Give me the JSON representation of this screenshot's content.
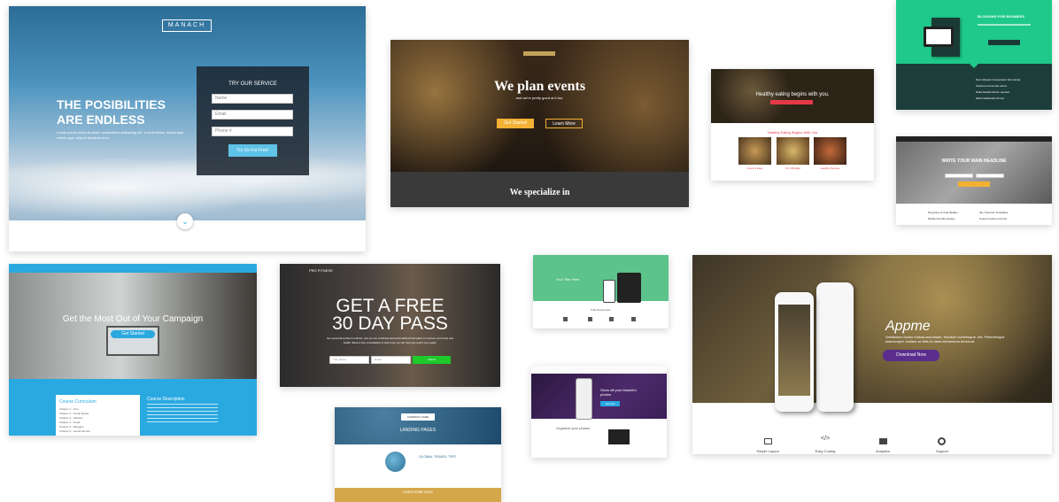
{
  "colors": {
    "accent_blue": "#2aa9e0",
    "accent_green": "#1ec98b",
    "accent_purple": "#5b2d8e",
    "accent_yellow": "#f2b134",
    "accent_red": "#e63946"
  },
  "manach": {
    "brand": "MANACH",
    "headline_1": "THE POSIBILITIES",
    "headline_2": "ARE ENDLESS",
    "body": "Lorem ipsum dolor sit amet, consectetur adipiscing elit. In erat metus, luctus quis metus eget, aliquet faucibus eros.",
    "form_title": "TRY OUR SERVICE",
    "name_placeholder": "Name",
    "email_placeholder": "Email",
    "phone_placeholder": "Phone #",
    "cta": "Try Us For Free!"
  },
  "events": {
    "title": "We plan events",
    "subtitle": "and we're pretty good at it too.",
    "btn_1": "Get Started",
    "btn_2": "Learn More",
    "footer": "We specialize in"
  },
  "food": {
    "banner": "Healthy eating begins with you.",
    "section_title": "Healthy Eating Begins With You",
    "items": [
      "Quick & Easy",
      "On A Budget",
      "Healthy Recipes"
    ]
  },
  "ebook": {
    "title": "BLOGGING FOR BUSINESS",
    "bullets": [
      "Nam Aliquam Consectetur Vel Lacinia",
      "Vivamus Commodo Lacus",
      "Nulla Facilisi Dictum Laoreet",
      "Morbi Sollicitudin Mi Vel"
    ]
  },
  "laptop": {
    "headline": "WRITE YOUR MAIN HEADLINE",
    "features": [
      "Drag Drop & Only Builder",
      "46+ Premium Templates",
      "Mobile Friendly Design",
      "Custom Colors & Fonts"
    ]
  },
  "campaign": {
    "headline": "Get the Most Out of Your Campaign",
    "cta": "Get Started",
    "curriculum_title": "Course Curriculum",
    "chapters": [
      "Chapter 1 - Intro",
      "Chapter 2 - Social Media",
      "Chapter 3 - Website",
      "Chapter 4 - Email",
      "Chapter 5 - Bloggers",
      "Chapter 6 - Facebook Ads"
    ],
    "description_title": "Course Description"
  },
  "fitness": {
    "brand": "PRO FITNESS",
    "headline_1": "GET A FREE",
    "headline_2": "30 DAY PASS",
    "body": "Get personal workout routines, one-on-one coaching and personalized food plans to improve your body and health. Book a free consultation to start now, we can help you reach your goals.",
    "name_placeholder": "Your Name",
    "email_placeholder": "Email",
    "cta": "Submit"
  },
  "mobile_app": {
    "title": "Your Title Here",
    "section": "Fully Responsive",
    "features": [
      "Icon",
      "Icon",
      "Icon",
      "Icon"
    ]
  },
  "photo_app": {
    "headline": "Show off your beautiful photos",
    "cta": "Get App",
    "section": "Organize your photos"
  },
  "travel": {
    "badge": "COMPANY NAME",
    "title": "LANDING PAGES",
    "subtitle": "GLOBAL TRAVEL TIPS",
    "footer": "SUBSCRIBE NOW"
  },
  "appme": {
    "brand": "Appme",
    "body": "Vestibulum luctus massa accumsan, tincidunt scelerisque, elit. Pellentesque ullamcorper. Nullam ac felis et diam elementum tincidunt.",
    "cta": "Download Now",
    "features": [
      "Simple Layout",
      "Easy Coding",
      "Analytics",
      "Support"
    ]
  }
}
